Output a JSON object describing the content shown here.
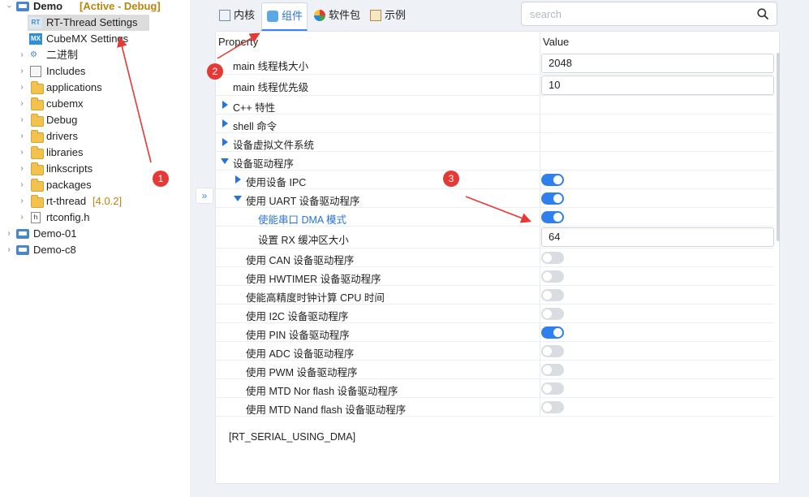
{
  "tree": {
    "project": "Demo",
    "project_status": "[Active - Debug]",
    "items": [
      {
        "label": "RT-Thread Settings",
        "icon": "rt-icon",
        "expand": ""
      },
      {
        "label": "CubeMX Settings",
        "icon": "mx-icon",
        "expand": ""
      },
      {
        "label": "二进制",
        "icon": "binaries-icon",
        "expand": "›"
      },
      {
        "label": "Includes",
        "icon": "includes-icon",
        "expand": "›"
      },
      {
        "label": "applications",
        "icon": "folder-icon",
        "expand": "›"
      },
      {
        "label": "cubemx",
        "icon": "folder-icon",
        "expand": "›"
      },
      {
        "label": "Debug",
        "icon": "folder-icon",
        "expand": "›"
      },
      {
        "label": "drivers",
        "icon": "folder-icon",
        "expand": "›"
      },
      {
        "label": "libraries",
        "icon": "folder-icon",
        "expand": "›"
      },
      {
        "label": "linkscripts",
        "icon": "folder-icon",
        "expand": "›"
      },
      {
        "label": "packages",
        "icon": "folder-icon",
        "expand": "›"
      },
      {
        "label": "rt-thread",
        "icon": "folder-icon",
        "expand": "›",
        "tag": "[4.0.2]"
      },
      {
        "label": "rtconfig.h",
        "icon": "header-file-icon",
        "expand": "›"
      }
    ],
    "other_projects": [
      "Demo-01",
      "Demo-c8"
    ]
  },
  "tabs": [
    {
      "label": "内核",
      "icon": "kernel-icon"
    },
    {
      "label": "组件",
      "icon": "components-icon"
    },
    {
      "label": "软件包",
      "icon": "packages-icon"
    },
    {
      "label": "示例",
      "icon": "examples-icon"
    }
  ],
  "search": {
    "placeholder": "search"
  },
  "table": {
    "col_property": "Property",
    "col_value": "Value",
    "rows": [
      {
        "label": "main 线程栈大小",
        "value": "2048"
      },
      {
        "label": "main 线程优先级",
        "value": "10"
      },
      {
        "label": "C++ 特性"
      },
      {
        "label": "shell 命令"
      },
      {
        "label": "设备虚拟文件系统"
      },
      {
        "label": "设备驱动程序"
      },
      {
        "label": "使用设备 IPC"
      },
      {
        "label": "使用 UART 设备驱动程序"
      },
      {
        "label": "使能串口 DMA 模式"
      },
      {
        "label": "设置 RX 缓冲区大小",
        "value": "64"
      },
      {
        "label": "使用 CAN 设备驱动程序"
      },
      {
        "label": "使用 HWTIMER 设备驱动程序"
      },
      {
        "label": "使能高精度时钟计算 CPU 时间"
      },
      {
        "label": "使用 I2C 设备驱动程序"
      },
      {
        "label": "使用 PIN 设备驱动程序"
      },
      {
        "label": "使用 ADC 设备驱动程序"
      },
      {
        "label": "使用 PWM 设备驱动程序"
      },
      {
        "label": "使用 MTD Nor flash 设备驱动程序"
      },
      {
        "label": "使用 MTD Nand flash 设备驱动程序"
      }
    ],
    "toggles": {
      "使用设备 IPC": true,
      "使用 UART 设备驱动程序": true,
      "使能串口 DMA 模式": true,
      "使用 CAN 设备驱动程序": false,
      "使用 HWTIMER 设备驱动程序": false,
      "使能高精度时钟计算 CPU 时间": false,
      "使用 I2C 设备驱动程序": false,
      "使用 PIN 设备驱动程序": true,
      "使用 ADC 设备驱动程序": false,
      "使用 PWM 设备驱动程序": false,
      "使用 MTD Nor flash 设备驱动程序": false,
      "使用 MTD Nand flash 设备驱动程序": false
    },
    "description": "[RT_SERIAL_USING_DMA]"
  },
  "collapse_button": "»",
  "annotations": [
    "1",
    "2",
    "3"
  ],
  "colors": {
    "accent": "#2f80ed",
    "annotation": "#e53935",
    "active_status": "#b8860b"
  }
}
